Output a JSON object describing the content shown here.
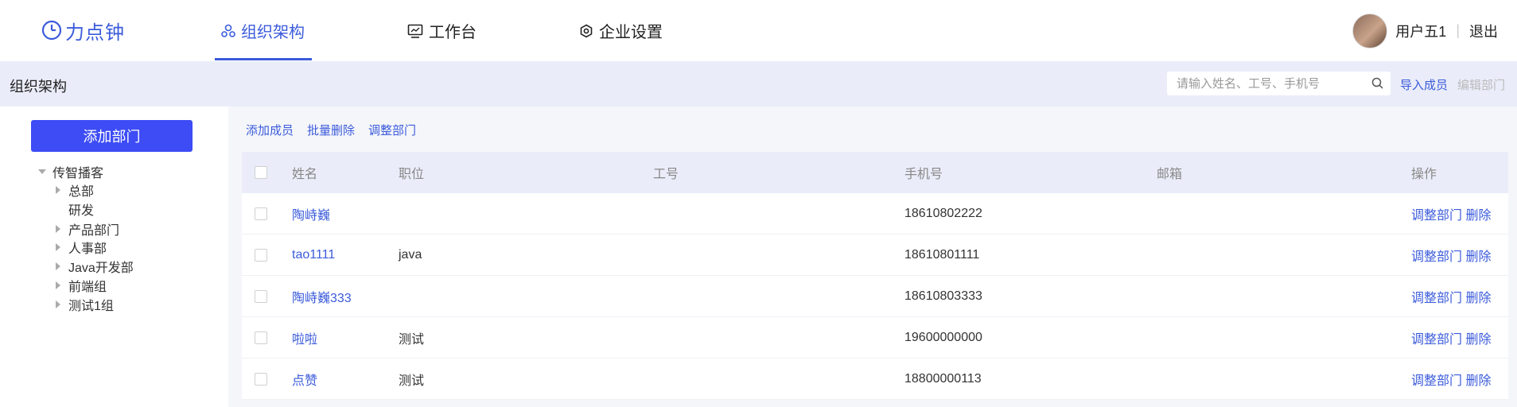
{
  "brand": {
    "name": "力点钟",
    "color": "#3b5bdb"
  },
  "nav": [
    {
      "label": "组织架构",
      "icon": "org-icon",
      "active": true
    },
    {
      "label": "工作台",
      "icon": "workbench-icon",
      "active": false
    },
    {
      "label": "企业设置",
      "icon": "gear-icon",
      "active": false
    }
  ],
  "user": {
    "name": "用户五1",
    "separator": "|",
    "logout": "退出"
  },
  "subbar": {
    "title": "组织架构",
    "search_placeholder": "请输入姓名、工号、手机号",
    "import_label": "导入成员",
    "edit_label": "编辑部门"
  },
  "sidebar": {
    "add_dept_label": "添加部门",
    "root": "传智播客",
    "items": [
      {
        "label": "总部",
        "expandable": true
      },
      {
        "label": "研发",
        "expandable": false
      },
      {
        "label": "产品部门",
        "expandable": true
      },
      {
        "label": "人事部",
        "expandable": true
      },
      {
        "label": "Java开发部",
        "expandable": true
      },
      {
        "label": "前端组",
        "expandable": true
      },
      {
        "label": "测试1组",
        "expandable": true
      }
    ]
  },
  "toolbar": {
    "add_member": "添加成员",
    "batch_delete": "批量删除",
    "adjust_dept": "调整部门"
  },
  "table": {
    "columns": [
      "姓名",
      "职位",
      "工号",
      "手机号",
      "邮箱",
      "操作"
    ],
    "rows": [
      {
        "name": "陶峙巍",
        "position": "",
        "number": "",
        "phone": "18610802222",
        "email": "",
        "op_adjust": "调整部门",
        "op_delete": "删除"
      },
      {
        "name": "tao1111",
        "position": "java",
        "number": "",
        "phone": "18610801111",
        "email": "",
        "op_adjust": "调整部门",
        "op_delete": "删除"
      },
      {
        "name": "陶峙巍333",
        "position": "",
        "number": "",
        "phone": "18610803333",
        "email": "",
        "op_adjust": "调整部门",
        "op_delete": "删除"
      },
      {
        "name": "啦啦",
        "position": "测试",
        "number": "",
        "phone": "19600000000",
        "email": "",
        "op_adjust": "调整部门",
        "op_delete": "删除"
      },
      {
        "name": "点赞",
        "position": "测试",
        "number": "",
        "phone": "18800000113",
        "email": "",
        "op_adjust": "调整部门",
        "op_delete": "删除"
      }
    ]
  }
}
